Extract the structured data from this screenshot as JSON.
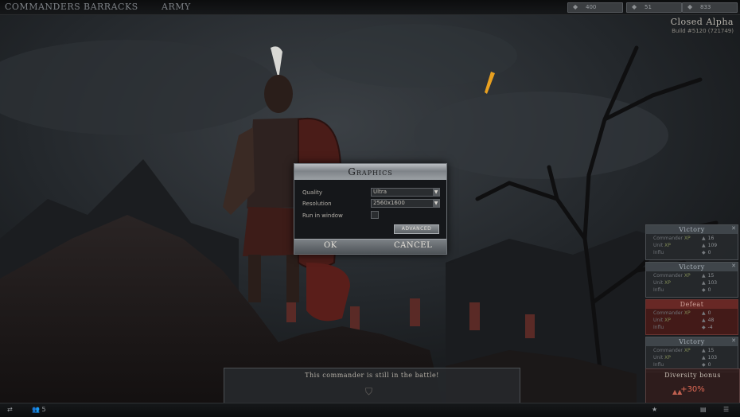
{
  "nav": {
    "commanders": "COMMANDERS",
    "barracks": "BARRACKS",
    "army": "ARMY"
  },
  "resources": [
    {
      "icon": "gold-icon",
      "value": "400"
    },
    {
      "icon": "food-icon",
      "value": "51"
    },
    {
      "icon": "influence-icon",
      "value": "833"
    }
  ],
  "build": {
    "title": "Closed Alpha",
    "build": "Build #5120 (721749)"
  },
  "dialog": {
    "title": "Graphics",
    "quality_label": "Quality",
    "quality_value": "Ultra",
    "resolution_label": "Resolution",
    "resolution_value": "2560x1600",
    "window_label": "Run in window",
    "advanced": "ADVANCED",
    "ok": "OK",
    "cancel": "CANCEL"
  },
  "battles": [
    {
      "result": "Victory",
      "commander_xp": "16",
      "unit_xp": "109",
      "influence": "0"
    },
    {
      "result": "Victory",
      "commander_xp": "15",
      "unit_xp": "103",
      "influence": "0"
    },
    {
      "result": "Defeat",
      "commander_xp": "0",
      "unit_xp": "48",
      "influence": "-4"
    },
    {
      "result": "Victory",
      "commander_xp": "15",
      "unit_xp": "103",
      "influence": "0"
    }
  ],
  "stat_labels": {
    "commander": "Commander ",
    "xp": "XP",
    "unit": "Unit ",
    "influence": "Influ"
  },
  "bonus": {
    "title": "Diversity bonus",
    "value": "+30%"
  },
  "banner": {
    "text": "This commander is still in the battle!"
  },
  "bottombar": {
    "squad_count": "5"
  },
  "colors": {
    "accent_defeat": "#6a3431",
    "bonus_value": "#e06a55"
  }
}
